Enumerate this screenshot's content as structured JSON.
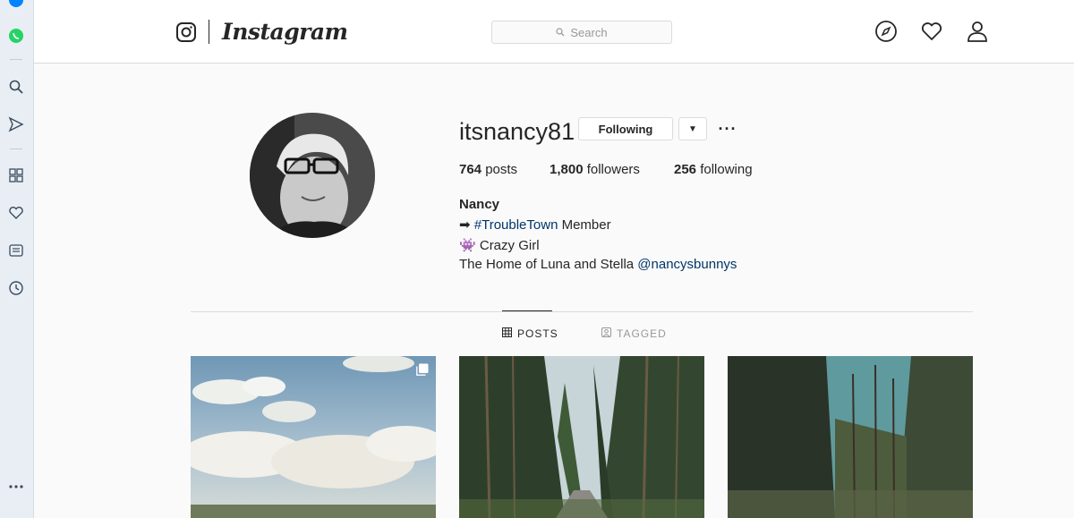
{
  "browser_rail": {
    "items": [
      {
        "icon": "messenger-icon",
        "color": "#0084ff"
      },
      {
        "icon": "whatsapp-icon",
        "color": "#25d366"
      },
      {
        "icon": "search-icon"
      },
      {
        "icon": "send-icon"
      },
      {
        "icon": "speed-dial-icon"
      },
      {
        "icon": "heart-icon"
      },
      {
        "icon": "news-icon"
      },
      {
        "icon": "history-icon"
      },
      {
        "icon": "more-icon"
      }
    ]
  },
  "topnav": {
    "brand": "Instagram",
    "search_placeholder": "Search",
    "icons": [
      "explore-icon",
      "activity-heart-icon",
      "profile-icon"
    ]
  },
  "profile": {
    "username": "itsnancy81",
    "following_button": "Following",
    "stats": [
      {
        "count": "764",
        "label": "posts"
      },
      {
        "count": "1,800",
        "label": "followers"
      },
      {
        "count": "256",
        "label": "following"
      }
    ],
    "full_name": "Nancy",
    "bio": {
      "line1_prefix": "➡",
      "line1_tag": "#TroubleTown",
      "line1_suffix": "Member",
      "line2_emoji": "👾",
      "line2_text": "Crazy Girl",
      "line3_text": "The Home of Luna and Stella",
      "line3_mention": "@nancysbunnys"
    }
  },
  "tabs": [
    {
      "label": "POSTS",
      "icon": "grid-icon",
      "active": true
    },
    {
      "label": "TAGGED",
      "icon": "tag-person-icon",
      "active": false
    }
  ],
  "posts": [
    {
      "subject": "sky-field",
      "multi": true
    },
    {
      "subject": "forest-road",
      "multi": false
    },
    {
      "subject": "pine-forest",
      "multi": false
    }
  ],
  "colors": {
    "link": "#003569",
    "border": "#dbdbdb",
    "background": "#fafafa"
  }
}
